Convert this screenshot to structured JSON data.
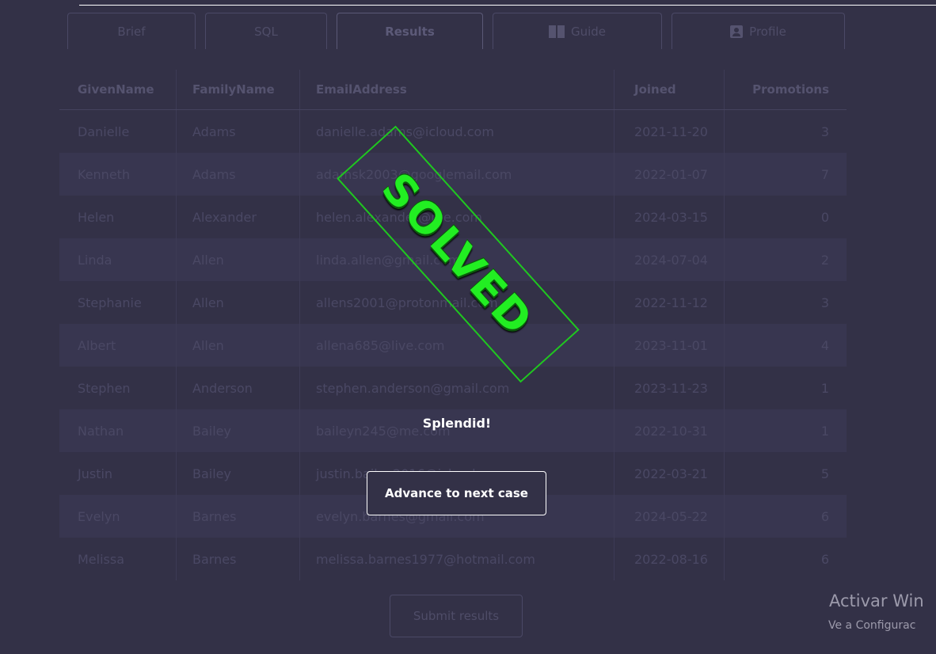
{
  "tabs": [
    {
      "label": "Brief",
      "icon": ""
    },
    {
      "label": "SQL",
      "icon": ""
    },
    {
      "label": "Results",
      "icon": ""
    },
    {
      "label": "Guide",
      "icon": "book-icon"
    },
    {
      "label": "Profile",
      "icon": "profile-icon"
    }
  ],
  "table": {
    "headers": [
      "GivenName",
      "FamilyName",
      "EmailAddress",
      "Joined",
      "Promotions"
    ],
    "rows": [
      [
        "Danielle",
        "Adams",
        "danielle.adams@icloud.com",
        "2021-11-20",
        "3"
      ],
      [
        "Kenneth",
        "Adams",
        "adamsk2003@googlemail.com",
        "2022-01-07",
        "7"
      ],
      [
        "Helen",
        "Alexander",
        "helen.alexander@me.com",
        "2024-03-15",
        "0"
      ],
      [
        "Linda",
        "Allen",
        "linda.allen@gmail.com",
        "2024-07-04",
        "2"
      ],
      [
        "Stephanie",
        "Allen",
        "allens2001@protonmail.com",
        "2022-11-12",
        "3"
      ],
      [
        "Albert",
        "Allen",
        "allena685@live.com",
        "2023-11-01",
        "4"
      ],
      [
        "Stephen",
        "Anderson",
        "stephen.anderson@gmail.com",
        "2023-11-23",
        "1"
      ],
      [
        "Nathan",
        "Bailey",
        "baileyn245@me.com",
        "2022-10-31",
        "1"
      ],
      [
        "Justin",
        "Bailey",
        "justin.bailey2016@icloud.com",
        "2022-03-21",
        "5"
      ],
      [
        "Evelyn",
        "Barnes",
        "evelyn.barnes@gmail.com",
        "2024-05-22",
        "6"
      ],
      [
        "Melissa",
        "Barnes",
        "melissa.barnes1977@hotmail.com",
        "2022-08-16",
        "6"
      ]
    ]
  },
  "submit_label": "Submit results",
  "overlay": {
    "stamp_text": "SOLVED",
    "message": "Splendid!",
    "advance_label": "Advance to next case"
  },
  "watermark": {
    "line1": "Activar Win",
    "line2": "Ve a Configurac"
  },
  "colors": {
    "background": "#333147",
    "stamp_green": "#22ee22"
  }
}
